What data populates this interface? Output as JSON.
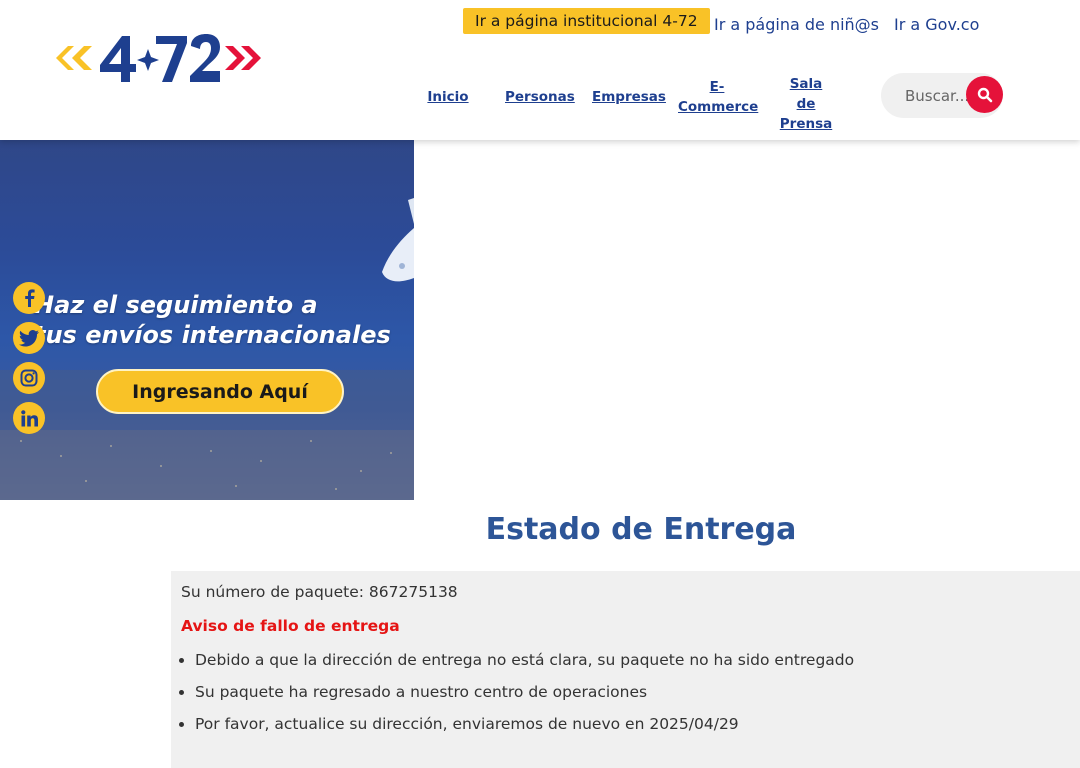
{
  "header": {
    "logo": {
      "text": "4-72",
      "icon": "logo-472",
      "colors": {
        "left_arrows": "#f9c227",
        "numbers": "#1e3f8f",
        "right_arrows": "#e5123a"
      }
    },
    "top_links": {
      "institutional": "Ir a página institucional 4-72",
      "ninos": "Ir a página de niñ@s",
      "gov": "Ir a Gov.co"
    },
    "nav": {
      "inicio": "Inicio",
      "personas": "Personas",
      "empresas": "Empresas",
      "ecommerce_1": "E-",
      "ecommerce_2": "Commerce",
      "sala_1": "Sala",
      "sala_2": "de",
      "sala_3": "Prensa"
    },
    "search": {
      "placeholder": "Buscar...",
      "icon": "search-icon"
    }
  },
  "banner": {
    "line1": "Haz el seguimiento a",
    "line2": "tus envíos internacionales",
    "cta": "Ingresando Aquí"
  },
  "social": [
    {
      "icon": "facebook-icon"
    },
    {
      "icon": "twitter-icon"
    },
    {
      "icon": "instagram-icon"
    },
    {
      "icon": "linkedin-icon"
    }
  ],
  "main": {
    "title": "Estado de Entrega",
    "package_line": "Su número de paquete: 867275138",
    "alert_title": "Aviso de fallo de entrega",
    "items": [
      "Debido a que la dirección de entrega no está clara, su paquete no ha sido entregado",
      "Su paquete ha regresado a nuestro centro de operaciones",
      "Por favor, actualice su dirección, enviaremos de nuevo en 2025/04/29"
    ]
  },
  "colors": {
    "brand_blue": "#1e3f8f",
    "brand_yellow": "#f9c227",
    "brand_red": "#e5123a",
    "title_blue": "#2d5597",
    "alert_red": "#e51414",
    "panel_bg": "#f0f0f0"
  }
}
